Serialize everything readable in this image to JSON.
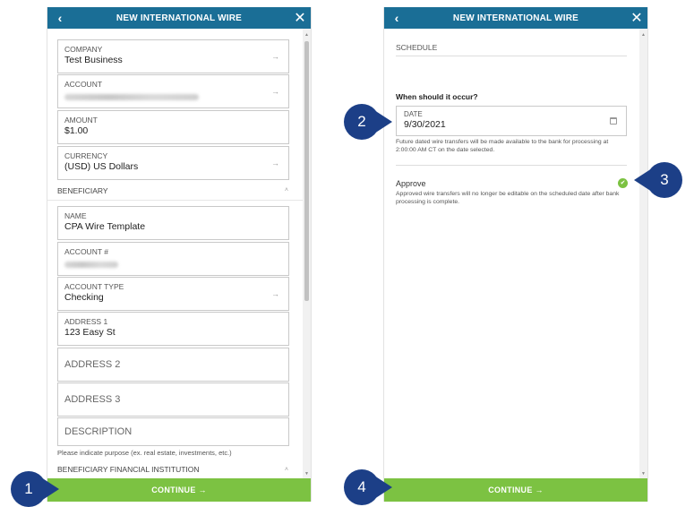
{
  "left_panel": {
    "title": "NEW INTERNATIONAL WIRE",
    "back_icon": "chevron-left-icon",
    "close_icon": "close-icon",
    "fields": {
      "company": {
        "label": "COMPANY",
        "value": "Test Business"
      },
      "account": {
        "label": "ACCOUNT"
      },
      "amount": {
        "label": "AMOUNT",
        "value": "$1.00"
      },
      "currency": {
        "label": "CURRENCY",
        "value": "(USD) US Dollars"
      },
      "name": {
        "label": "NAME",
        "value": "CPA Wire Template"
      },
      "account_number": {
        "label": "ACCOUNT #"
      },
      "account_type": {
        "label": "ACCOUNT TYPE",
        "value": "Checking"
      },
      "address1": {
        "label": "ADDRESS 1",
        "value": "123 Easy St"
      },
      "address2": {
        "placeholder": "ADDRESS 2"
      },
      "address3": {
        "placeholder": "ADDRESS 3"
      },
      "description": {
        "placeholder": "DESCRIPTION"
      }
    },
    "beneficiary_section": "BENEFICIARY",
    "description_hint": "Please indicate purpose (ex. real estate, investments, etc.)",
    "financial_institution_section": "BENEFICIARY FINANCIAL INSTITUTION",
    "continue_label": "CONTINUE →"
  },
  "right_panel": {
    "title": "NEW INTERNATIONAL WIRE",
    "schedule_label": "SCHEDULE",
    "when_label": "When should it occur?",
    "date_label": "DATE",
    "date_value": "9/30/2021",
    "date_note": "Future dated wire transfers will be made available to the bank for processing at 2:00:00 AM CT on the date selected.",
    "approve_label": "Approve",
    "approve_checked": true,
    "approve_note": "Approved wire transfers will no longer be editable on the scheduled date after bank processing is complete.",
    "continue_label": "CONTINUE →"
  },
  "markers": [
    "1",
    "2",
    "3",
    "4"
  ],
  "colors": {
    "header": "#1a6e96",
    "continue": "#7cc242",
    "marker": "#1c3f87",
    "check": "#7cc242"
  }
}
